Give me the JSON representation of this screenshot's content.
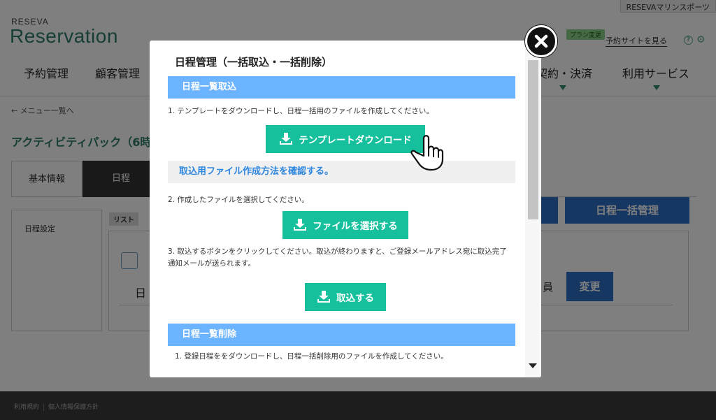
{
  "header": {
    "account_name": "RESEVAマリンスポーツ",
    "brand_small": "RESEVA",
    "brand_big": "Reservation",
    "plan_badge": "プラン変更",
    "reserve_site_link": "予約サイトを見る",
    "help_icon": "?"
  },
  "nav": {
    "items": [
      "予約管理",
      "顧客管理",
      "契約・決済",
      "利用サービス"
    ]
  },
  "page": {
    "back_link": "← メニュー一覧へ",
    "title": "アクティビティパック（6時",
    "tabs": [
      "基本情報",
      "日程"
    ],
    "side_label": "日程設定",
    "list_tag": "リスト",
    "row_text": "日",
    "bulk_button": "日程一括管理",
    "row_staff": "員",
    "change_button": "変更"
  },
  "footer": {
    "links": [
      "利用規約",
      "個人情報保護方針"
    ]
  },
  "modal": {
    "title": "日程管理（一括取込・一括削除）",
    "import_section": {
      "header": "日程一覧取込",
      "step1": "1. テンプレートをダウンロードし、日程一括用のファイルを作成してください。",
      "template_button": "テンプレートダウンロード",
      "howto_link": "取込用ファイル作成方法を確認する。",
      "step2": "2. 作成したファイルを選択してください。",
      "select_file_button": "ファイルを選択する",
      "step3_line1": "3. 取込するボタンをクリックしてください。取込が終わりますと、ご登録メールアドレス宛に取込完了",
      "step3_line2": "通知メールが送られます。",
      "import_button": "取込する"
    },
    "delete_section": {
      "header": "日程一覧削除",
      "step1": "1. 登録日程ををダウンロードし、日程一括削除用のファイルを作成してください。"
    }
  },
  "colors": {
    "section_header": "#6cb4ff",
    "action_green": "#16c09c",
    "link_blue": "#2e86de",
    "brand_green": "#2f7d6d",
    "page_button_blue": "#2b6fc4"
  },
  "icons": {
    "close": "close-icon",
    "download": "download-icon",
    "pointer": "hand-pointer-icon",
    "gear": "gear-icon",
    "help": "help-icon"
  }
}
